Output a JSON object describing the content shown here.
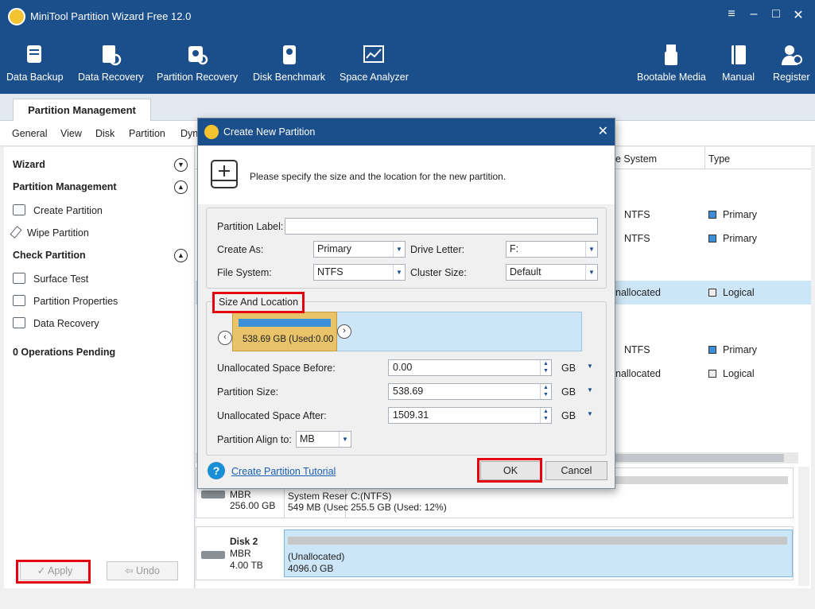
{
  "window": {
    "title": "MiniTool Partition Wizard Free 12.0"
  },
  "toolbar": {
    "left": [
      "Data Backup",
      "Data Recovery",
      "Partition Recovery",
      "Disk Benchmark",
      "Space Analyzer"
    ],
    "right": [
      "Bootable Media",
      "Manual",
      "Register"
    ]
  },
  "tabs": {
    "active": "Partition Management"
  },
  "menu": [
    "General",
    "View",
    "Disk",
    "Partition",
    "Dyn"
  ],
  "left_panel": {
    "wizard": "Wizard",
    "partition_management": "Partition Management",
    "pm_items": [
      "Create Partition",
      "Wipe Partition"
    ],
    "check_partition": "Check Partition",
    "cp_items": [
      "Surface Test",
      "Partition Properties",
      "Data Recovery"
    ],
    "pending": "0 Operations Pending",
    "apply": "Apply",
    "undo": "Undo"
  },
  "table": {
    "headers": {
      "fs": "e System",
      "type": "Type"
    },
    "rows": [
      {
        "fs": "NTFS",
        "type": "Primary"
      },
      {
        "fs": "NTFS",
        "type": "Primary"
      },
      {
        "fs": "nallocated",
        "type": "Logical"
      },
      {
        "fs": "NTFS",
        "type": "Primary"
      },
      {
        "fs": "nallocated",
        "type": "Logical"
      }
    ]
  },
  "disk1": {
    "type": "MBR",
    "size": "256.00 GB",
    "p1_name": "System Reser",
    "p1_info": "549 MB (Usec",
    "p2_name": "C:(NTFS)",
    "p2_info": "255.5 GB (Used: 12%)"
  },
  "disk2": {
    "name": "Disk 2",
    "type": "MBR",
    "size": "4.00 TB",
    "p_name": "(Unallocated)",
    "p_info": "4096.0 GB"
  },
  "dialog": {
    "title": "Create New Partition",
    "instruction": "Please specify the size and the location for the new partition.",
    "partition_label": "Partition Label:",
    "partition_label_value": "",
    "create_as_label": "Create As:",
    "create_as_value": "Primary",
    "drive_letter_label": "Drive Letter:",
    "drive_letter_value": "F:",
    "file_system_label": "File System:",
    "file_system_value": "NTFS",
    "cluster_size_label": "Cluster Size:",
    "cluster_size_value": "Default",
    "size_location": "Size And Location",
    "bar_text": "538.69 GB (Used:0.00",
    "unalloc_before_label": "Unallocated Space Before:",
    "unalloc_before_value": "0.00",
    "partition_size_label": "Partition Size:",
    "partition_size_value": "538.69",
    "unalloc_after_label": "Unallocated Space After:",
    "unalloc_after_value": "1509.31",
    "unit": "GB",
    "align_label": "Partition Align to:",
    "align_value": "MB",
    "tutorial_link": "Create Partition Tutorial",
    "ok": "OK",
    "cancel": "Cancel"
  },
  "colors": {
    "title_bar": "#1b4f8c",
    "highlight_red": "#e3000f",
    "partition_bar": "#e8c36a",
    "used_fill": "#3b8fd9",
    "link": "#1a5fb4"
  }
}
